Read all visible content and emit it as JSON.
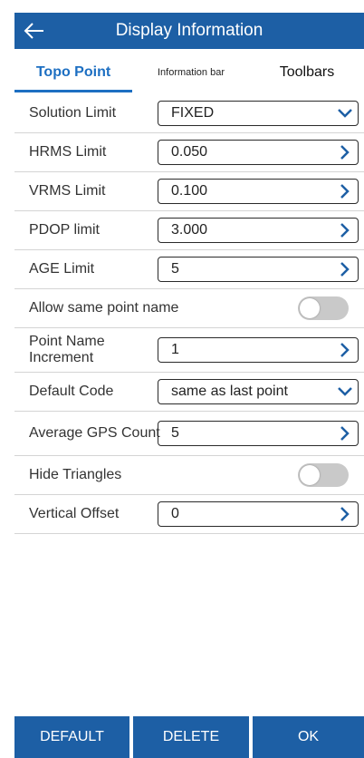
{
  "header": {
    "title": "Display Information",
    "back_icon": "arrow-left-icon"
  },
  "tabs": [
    {
      "label": "Topo Point",
      "active": true
    },
    {
      "label": "Information bar",
      "active": false
    },
    {
      "label": "Toolbars",
      "active": false
    }
  ],
  "accent_color": "#1d5fa5",
  "active_tab_color": "#1d6fc2",
  "rows": [
    {
      "label": "Solution Limit",
      "value": "FIXED",
      "control": "dropdown"
    },
    {
      "label": "HRMS Limit",
      "value": "0.050",
      "control": "chevron"
    },
    {
      "label": "VRMS Limit",
      "value": "0.100",
      "control": "chevron"
    },
    {
      "label": "PDOP limit",
      "value": "3.000",
      "control": "chevron"
    },
    {
      "label": "AGE Limit",
      "value": "5",
      "control": "chevron"
    },
    {
      "label": "Allow same point name",
      "control": "toggle",
      "on": false
    },
    {
      "label": "Point Name Increment",
      "value": "1",
      "control": "chevron"
    },
    {
      "label": "Default Code",
      "value": "same as last point",
      "control": "dropdown"
    },
    {
      "label": "Average GPS Count",
      "value": "5",
      "control": "chevron"
    },
    {
      "label": "Hide Triangles",
      "control": "toggle",
      "on": false
    },
    {
      "label": "Vertical Offset",
      "value": "0",
      "control": "chevron"
    }
  ],
  "footer": {
    "default_label": "DEFAULT",
    "delete_label": "DELETE",
    "ok_label": "OK"
  }
}
